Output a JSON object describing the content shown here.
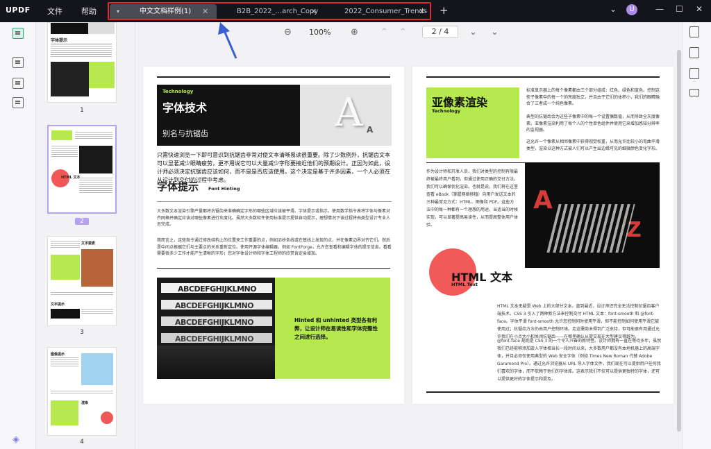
{
  "app": {
    "logo_up": "UPDF",
    "menu": [
      "文件",
      "帮助"
    ],
    "tabs": [
      {
        "label": "中文文档样例(1)",
        "active": true
      },
      {
        "label": "B2B_2022_...arch_Copy",
        "active": false
      },
      {
        "label": "2022_Consumer_Trends",
        "active": false
      }
    ],
    "tab_dropdown": "▾",
    "tab_close": "✕",
    "new_tab": "+",
    "user_initial": "U",
    "window_controls": [
      "⌄",
      "—",
      "☐",
      "✕"
    ]
  },
  "toolbar": {
    "zoom_out": "⊖",
    "zoom": "100%",
    "zoom_in": "⊕",
    "first_page": "⌃",
    "prev_page": "⌃",
    "page_current": "2",
    "page_sep": "/",
    "page_total": "4",
    "next_page": "⌄",
    "last_page": "⌄"
  },
  "thumbnails": [
    {
      "number": "1",
      "title": "字体提示"
    },
    {
      "number": "2",
      "title": "HTML 文本"
    },
    {
      "number": "3",
      "title": "文字要素",
      "subtitle": "文字提示"
    },
    {
      "number": "4",
      "title": "图像提示",
      "subtitle": "渲染"
    }
  ],
  "left_page": {
    "banner_tag": "Technology",
    "banner_title": "字体技术",
    "banner_sub": "别名与抗锯齿",
    "banner_letter": "A",
    "intro": "只需快速浏览一下即可意识到抗锯齿非常对使文本清晰易读很重要。除了少数例外，抗锯齿文本可以显著减少眼睛疲劳，更不用说它可以大量减少字形要接近他们的预期设计。正因为如此，设计师必须决定抗锯齿应该如何，而不是是否应该使用。这个决定是基于许多因素，一个人必须在从设计到交付的过程中考虑。",
    "section_title": "字体提示",
    "section_sub": "Font Hinting",
    "para1": "大多数文本渲染引擎产量都将抗锯齿来准确确定字形的哪些区域应该被平滑。字体提示或指示，使用数学指令表将字体与像素对齐网格并确定应该对哪些像素进行灰度化。虽然大多数软件使用标准提示提供自动提示，理想情况下该过程将由类型设计专业人员完成。",
    "para2": "简而言之，这些指令通过修改结构上的位置来工作重要的点，例如沿桥条线或在基线上发现的点，并在像素边界对齐它们。然后是中间点根据它们与主要点的关系重新定位。使用开源字体编辑器，例如 FontForge，允许您查看和编辑字体的提示信息。看看需要很多少工作才能产生清晰的字形；您对字体设计师和字体工程师的欣赏肯定会增加。",
    "img_text": "ABCDEFGHIJKLMNO",
    "callout": "Hinted 和 unhinted 类型各有利弊，让设计师在易读性和字体完整性之间进行选择。"
  },
  "right_page": {
    "banner_title": "亚像素渲染",
    "banner_tag": "Technology",
    "para_top1": "标准显示器上的每个像素都由三个部分组成：红色、绿色和蓝色。控制这些子像素中的每一个的亮度独立，并且由于它们的体积小，我们的眼睛融合了三者成一个纯色像素。",
    "para_top2": "典型的抗锯齿会为这些子像素中的每一个设置偶数值，从而导致全灰度像素。亚像素渲染利用了每个人的个性单色组件并使用它来增加感知分辨率的监视器。",
    "para_top3": "这允许一个像素从相邻像素中获得视觉权重，从而允许比较小的弯曲平滑类型，渲染以这种方式被人们可以产生出边缘可见的细微颜色变化字形。",
    "para_mid": "作为设计师和开发人员，我们对类型的控制有限最终被最终用户看到，但通过使用正确的交付方法，我们可以确保优化渲染。也就是说，我们将在这里查看 eBook（掌握网络移植）向用户发送文本的三种最常见方式：HTML、图像和 PDF。这些方法中的每一种都有一个理想的用途，当适当的时候实现，可以显著提高易读性，从而提高整体用户体验。",
    "circle_title": "HTML 文本",
    "circle_sub": "HTML Text",
    "para_bottom1": "HTML 文本无疑是 Web 上的大部分文本。直到最近，设计师还完全无法控制抗锯齿客户端技术。CSS 3 引入了两种新方法来控制交付 HTML 文本：font-smooth 和 @font-face。字体平滑 font-smooth 允许您控制何时使用平滑，但不能控制如何使用平滑它被使用过；抗锯齿方法仍由用户控制环境。走这需商未得到广泛支持，但可能很有用通过允许我们在小点大小和关闭抗锯齿——在哪里确认从提交现在大型建议得越为。",
    "para_bottom2": "@font-face 规则是 CSS 3 的一个令人兴奋的新特性。设计师拥有一直在等待多年，虽然我们已经能够添加嵌入字体相当长一段时间以来，大多数用户都没有本地机器上的高端字体，并且必须仅使用典型的 Web 安全字体（例如 Times New Roman 代替 Adobe Garamond Pro）。通过允许浏览器从 URL 导入字体文件，我们现在可以提供用户任何我们喜欢的字体，而不依赖于他们的字体库。这表示我们不仅可以提供更独特的字体，还可以提供更好的字体提示和提及。"
  }
}
